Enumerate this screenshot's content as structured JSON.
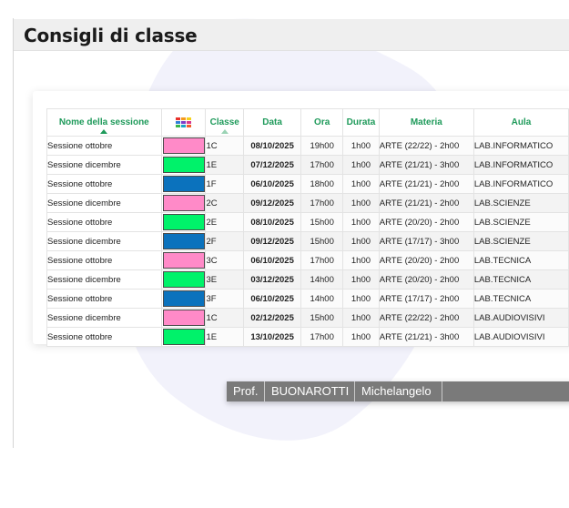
{
  "page": {
    "title": "Consigli di classe"
  },
  "colors": {
    "accent_header": "#1e9a5a",
    "pink": "#ff8ac8",
    "green": "#00f26a",
    "blue": "#0b72bd",
    "teacher_bar": "#7a7a7a"
  },
  "table": {
    "columns": {
      "nome": "Nome della sessione",
      "colore": "color-grid-icon",
      "classe": "Classe",
      "data": "Data",
      "ora": "Ora",
      "durata": "Durata",
      "materia": "Materia",
      "aula": "Aula"
    },
    "rows": [
      {
        "nome": "Sessione ottobre",
        "colore": "#ff8ac8",
        "classe": "1C",
        "data": "08/10/2025",
        "ora": "19h00",
        "durata": "1h00",
        "materia": "ARTE (22/22) - 2h00",
        "aula": "LAB.INFORMATICO"
      },
      {
        "nome": "Sessione dicembre",
        "colore": "#00f26a",
        "classe": "1E",
        "data": "07/12/2025",
        "ora": "17h00",
        "durata": "1h00",
        "materia": "ARTE (21/21) - 3h00",
        "aula": "LAB.INFORMATICO"
      },
      {
        "nome": "Sessione ottobre",
        "colore": "#0b72bd",
        "classe": "1F",
        "data": "06/10/2025",
        "ora": "18h00",
        "durata": "1h00",
        "materia": "ARTE (21/21) - 2h00",
        "aula": "LAB.INFORMATICO"
      },
      {
        "nome": "Sessione dicembre",
        "colore": "#ff8ac8",
        "classe": "2C",
        "data": "09/12/2025",
        "ora": "17h00",
        "durata": "1h00",
        "materia": "ARTE (21/21) - 2h00",
        "aula": "LAB.SCIENZE"
      },
      {
        "nome": "Sessione ottobre",
        "colore": "#00f26a",
        "classe": "2E",
        "data": "08/10/2025",
        "ora": "15h00",
        "durata": "1h00",
        "materia": "ARTE (20/20) - 2h00",
        "aula": "LAB.SCIENZE"
      },
      {
        "nome": "Sessione dicembre",
        "colore": "#0b72bd",
        "classe": "2F",
        "data": "09/12/2025",
        "ora": "15h00",
        "durata": "1h00",
        "materia": "ARTE (17/17) - 3h00",
        "aula": "LAB.SCIENZE"
      },
      {
        "nome": "Sessione ottobre",
        "colore": "#ff8ac8",
        "classe": "3C",
        "data": "06/10/2025",
        "ora": "17h00",
        "durata": "1h00",
        "materia": "ARTE (20/20) - 2h00",
        "aula": "LAB.TECNICA"
      },
      {
        "nome": "Sessione dicembre",
        "colore": "#00f26a",
        "classe": "3E",
        "data": "03/12/2025",
        "ora": "14h00",
        "durata": "1h00",
        "materia": "ARTE (20/20) - 2h00",
        "aula": "LAB.TECNICA"
      },
      {
        "nome": "Sessione ottobre",
        "colore": "#0b72bd",
        "classe": "3F",
        "data": "06/10/2025",
        "ora": "14h00",
        "durata": "1h00",
        "materia": "ARTE (17/17) - 2h00",
        "aula": "LAB.TECNICA"
      },
      {
        "nome": "Sessione dicembre",
        "colore": "#ff8ac8",
        "classe": "1C",
        "data": "02/12/2025",
        "ora": "15h00",
        "durata": "1h00",
        "materia": "ARTE (22/22) - 2h00",
        "aula": "LAB.AUDIOVISIVI"
      },
      {
        "nome": "Sessione ottobre",
        "colore": "#00f26a",
        "classe": "1E",
        "data": "13/10/2025",
        "ora": "17h00",
        "durata": "1h00",
        "materia": "ARTE (21/21) - 3h00",
        "aula": "LAB.AUDIOVISIVI"
      }
    ]
  },
  "teacher": {
    "title": "Prof.",
    "surname": "BUONAROTTI",
    "name": "Michelangelo"
  }
}
